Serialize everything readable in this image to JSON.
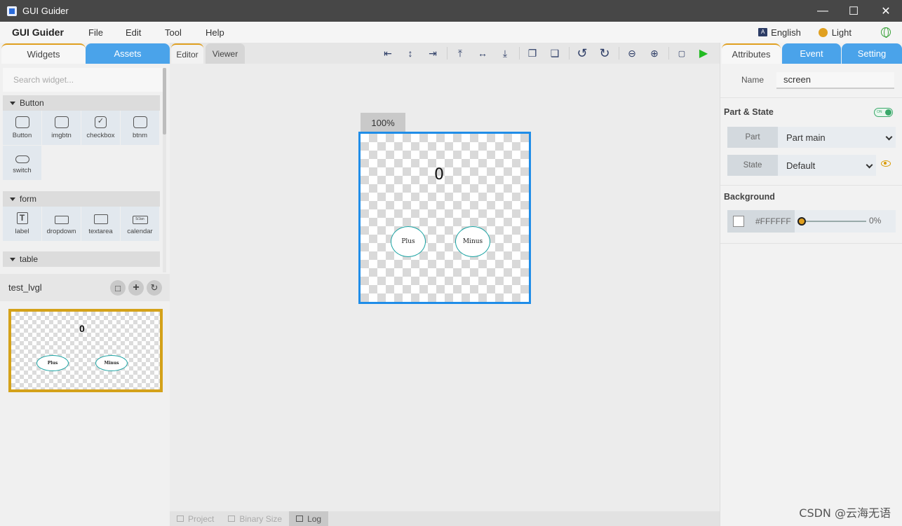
{
  "window": {
    "title": "GUI Guider"
  },
  "menubar": {
    "brand": "GUI Guider",
    "items": [
      "File",
      "Edit",
      "Tool",
      "Help"
    ],
    "language": "English",
    "theme": "Light"
  },
  "left_panel": {
    "tabs": [
      "Widgets",
      "Assets"
    ],
    "active_tab": "Widgets",
    "search_placeholder": "Search widget...",
    "sections": [
      {
        "title": "Button",
        "widgets": [
          "Button",
          "imgbtn",
          "checkbox",
          "btnm",
          "switch"
        ]
      },
      {
        "title": "form",
        "widgets": [
          "label",
          "dropdown",
          "textarea",
          "calendar"
        ]
      },
      {
        "title": "table",
        "widgets": []
      }
    ],
    "calendar_icon_text": "5/Jan",
    "project_name": "test_lvgl",
    "thumbnail": {
      "counter": "0",
      "buttons": [
        "Plus",
        "Minus"
      ]
    }
  },
  "editor": {
    "tabs": [
      "Editor",
      "Viewer"
    ],
    "active_tab": "Editor",
    "zoom": "100%",
    "screen": {
      "counter": "0",
      "buttons": [
        "Plus",
        "Minus"
      ]
    },
    "bottom_tabs": [
      "Project",
      "Binary Size",
      "Log"
    ],
    "active_bottom_tab": "Log",
    "toolbar_icons": [
      "align-left-icon",
      "align-center-icon",
      "align-right-icon",
      "align-top-icon",
      "align-middle-icon",
      "align-bottom-icon",
      "bring-front-icon",
      "send-back-icon",
      "undo-icon",
      "redo-icon",
      "zoom-out-icon",
      "zoom-in-icon",
      "code-icon",
      "run-icon"
    ]
  },
  "right_panel": {
    "tabs": [
      "Attributes",
      "Event",
      "Setting"
    ],
    "active_tab": "Attributes",
    "name_label": "Name",
    "name_value": "screen",
    "part_state_title": "Part & State",
    "toggle_text": "ON",
    "part_label": "Part",
    "part_value": "Part main",
    "state_label": "State",
    "state_value": "Default",
    "background_title": "Background",
    "bg_color": "#FFFFFF",
    "bg_opacity": "0%"
  },
  "colors": {
    "accent": "#4aa3ea",
    "selection": "#1f8de8",
    "highlight": "#e0a020",
    "run": "#22bb22"
  },
  "watermark": "CSDN @云海无语"
}
